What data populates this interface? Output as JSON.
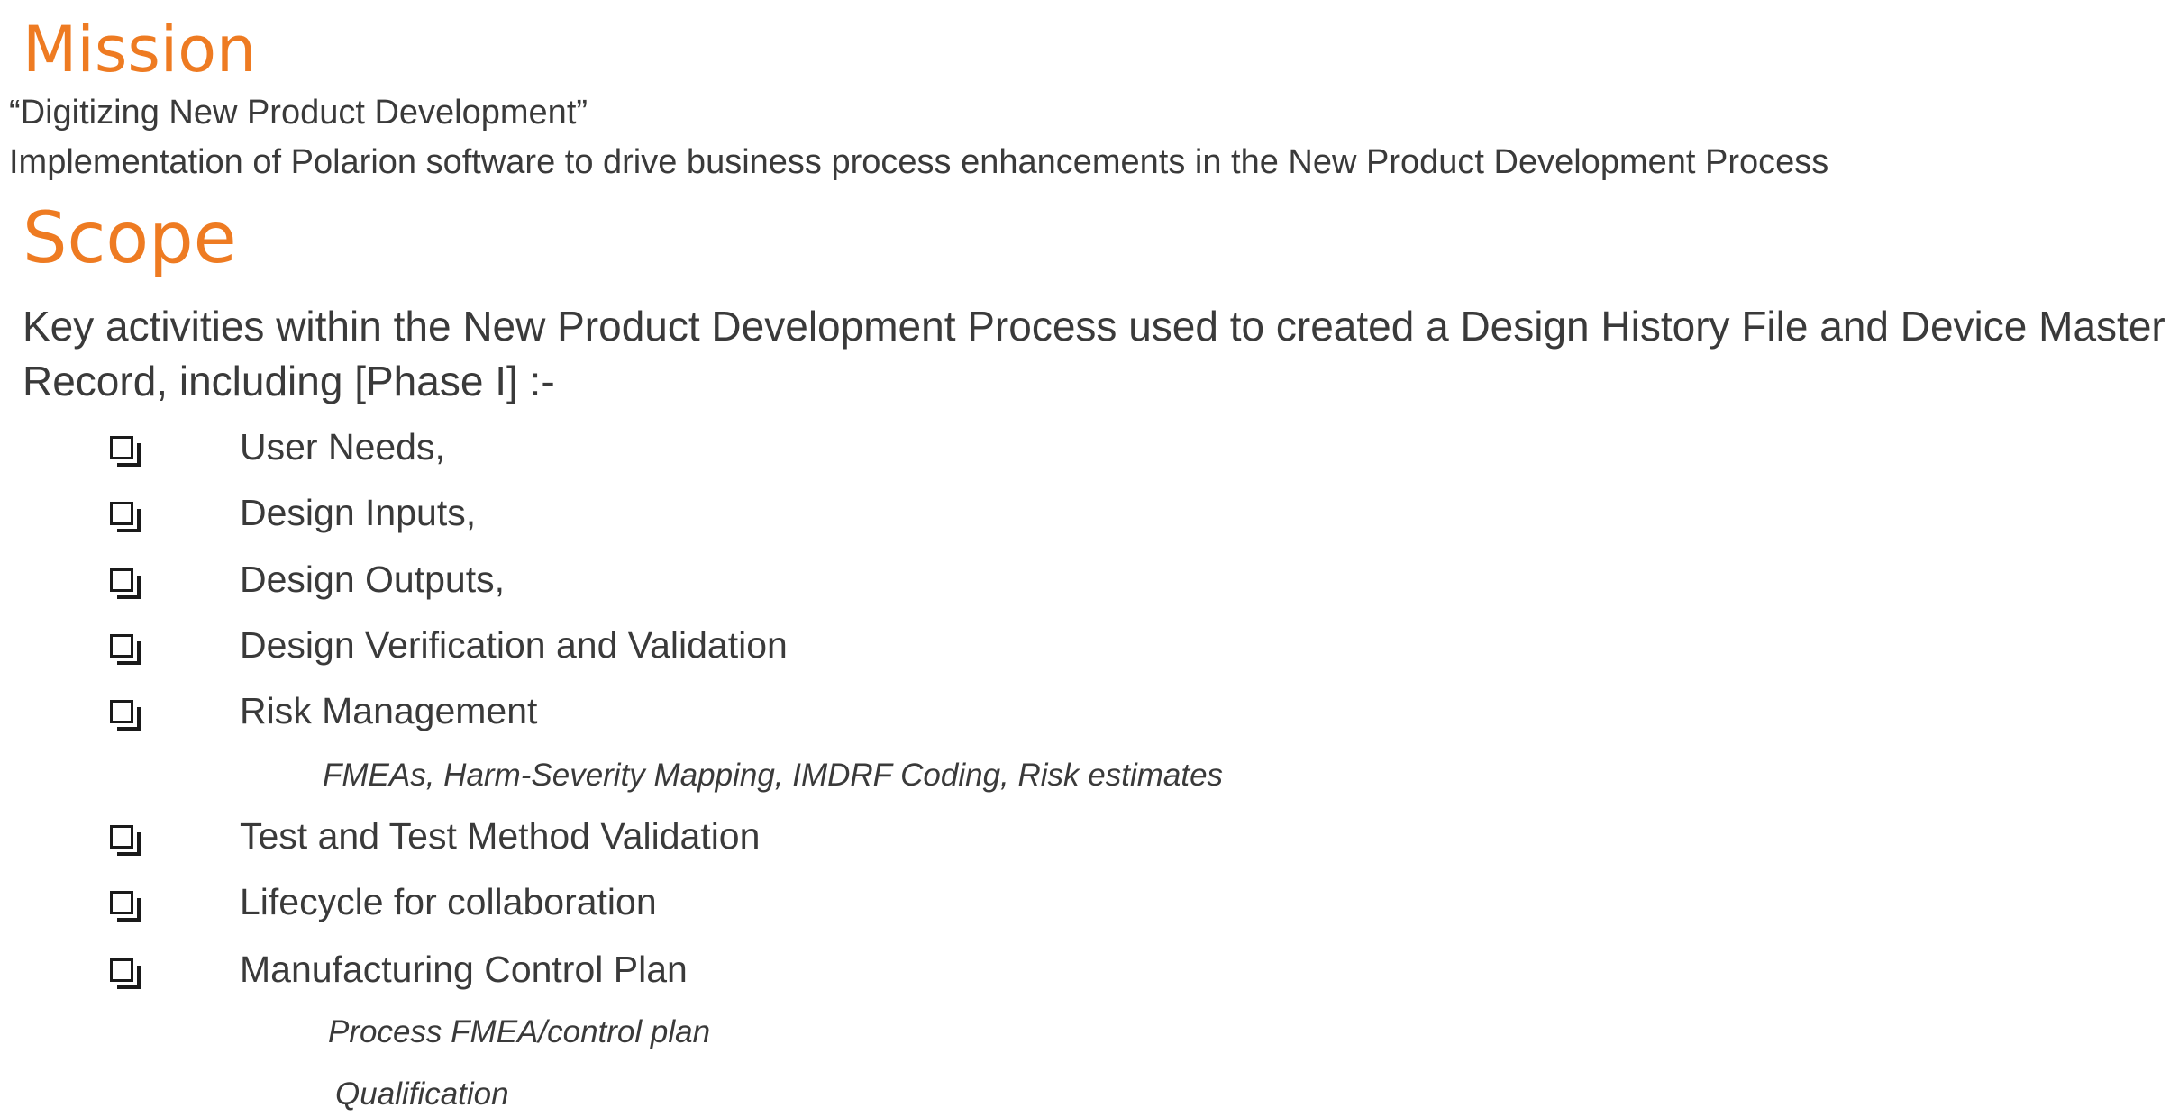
{
  "mission": {
    "heading": "Mission",
    "quote": "“Digitizing New Product Development”",
    "description": "Implementation of Polarion software to drive business process enhancements in the New Product Development Process"
  },
  "scope": {
    "heading": "Scope",
    "intro": "Key activities within the New Product Development Process used to created a Design History File and Device Master Record, including [Phase I] :-",
    "items": [
      {
        "label": "User Needs,"
      },
      {
        "label": "Design Inputs,"
      },
      {
        "label": "Design Outputs,"
      },
      {
        "label": "Design Verification and Validation"
      },
      {
        "label": "Risk Management",
        "details": [
          "FMEAs, Harm-Severity Mapping, IMDRF Coding, Risk estimates"
        ]
      },
      {
        "label": "Test and Test Method Validation"
      },
      {
        "label": "Lifecycle for collaboration"
      },
      {
        "label": "Manufacturing Control Plan",
        "details": [
          "Process FMEA/control plan",
          "Qualification"
        ]
      }
    ]
  },
  "icons": {
    "checkbox": "shadowed-checkbox-icon"
  }
}
